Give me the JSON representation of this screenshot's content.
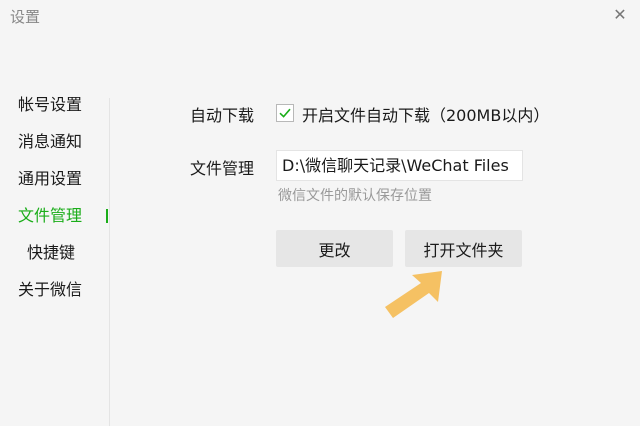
{
  "window": {
    "title": "设置",
    "close_glyph": "✕"
  },
  "sidebar": {
    "items": [
      {
        "label": "帐号设置"
      },
      {
        "label": "消息通知"
      },
      {
        "label": "通用设置"
      },
      {
        "label": "文件管理"
      },
      {
        "label": "快捷键"
      },
      {
        "label": "关于微信"
      }
    ],
    "active_index": 3,
    "active_color": "#1aad19"
  },
  "content": {
    "auto_download": {
      "label": "自动下载",
      "checked": true,
      "checkbox_label": "开启文件自动下载（200MB以内）"
    },
    "file_management": {
      "label": "文件管理",
      "path_value": "D:\\微信聊天记录\\WeChat Files",
      "hint": "微信文件的默认保存位置"
    },
    "buttons": {
      "change_label": "更改",
      "open_folder_label": "打开文件夹"
    },
    "annotation": {
      "arrow_color": "#f5c163",
      "arrow_icon": "arrow-pointer-icon"
    }
  }
}
